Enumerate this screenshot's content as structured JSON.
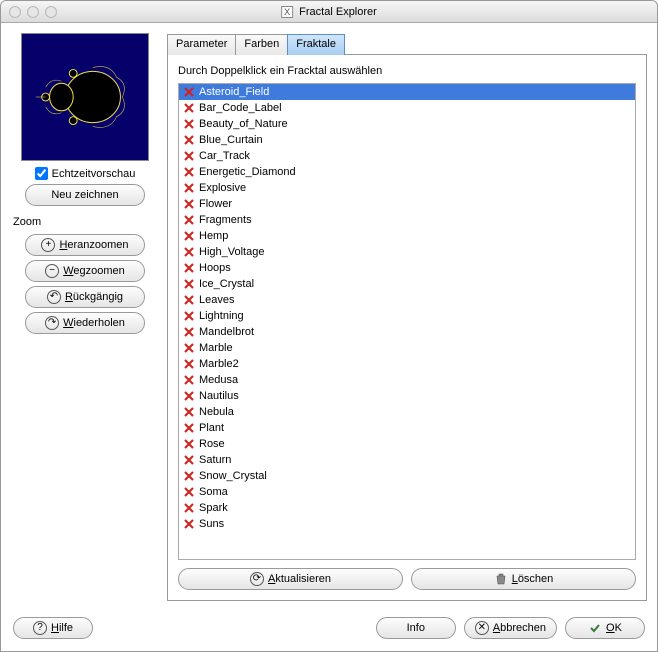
{
  "window": {
    "title": "Fractal Explorer"
  },
  "left": {
    "realtime_label": "Echtzeitvorschau",
    "realtime_checked": true,
    "redraw": "Neu zeichnen",
    "zoom_label": "Zoom",
    "zoom_in": "Heranzoomen",
    "zoom_out": "Wegzoomen",
    "undo": "Rückgängig",
    "redo": "Wiederholen"
  },
  "tabs": [
    {
      "label": "Parameter"
    },
    {
      "label": "Farben"
    },
    {
      "label": "Fraktale",
      "active": true
    }
  ],
  "panel": {
    "instruction": "Durch Doppelklick ein Fracktal auswählen",
    "items": [
      "Asteroid_Field",
      "Bar_Code_Label",
      "Beauty_of_Nature",
      "Blue_Curtain",
      "Car_Track",
      "Energetic_Diamond",
      "Explosive",
      "Flower",
      "Fragments",
      "Hemp",
      "High_Voltage",
      "Hoops",
      "Ice_Crystal",
      "Leaves",
      "Lightning",
      "Mandelbrot",
      "Marble",
      "Marble2",
      "Medusa",
      "Nautilus",
      "Nebula",
      "Plant",
      "Rose",
      "Saturn",
      "Snow_Crystal",
      "Soma",
      "Spark",
      "Suns"
    ],
    "selected_index": 0,
    "refresh": "Aktualisieren",
    "delete": "Löschen"
  },
  "bottom": {
    "help": "Hilfe",
    "info": "Info",
    "cancel": "Abbrechen",
    "ok": "OK"
  }
}
